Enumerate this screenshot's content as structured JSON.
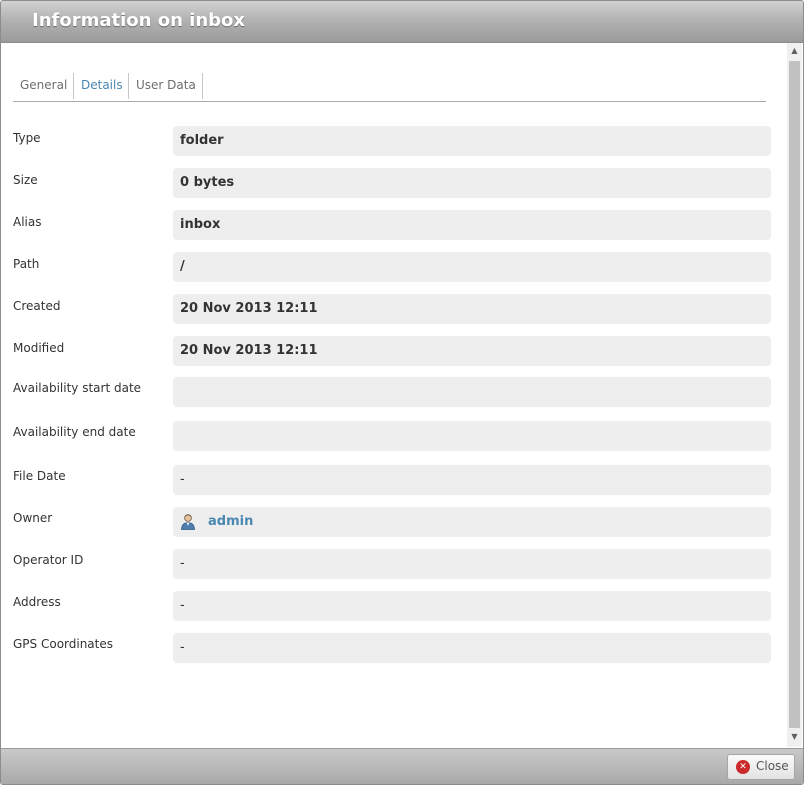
{
  "dialog": {
    "title": "Information on inbox",
    "tabs": [
      {
        "label": "General",
        "active": false
      },
      {
        "label": "Details",
        "active": true
      },
      {
        "label": "User Data",
        "active": false
      }
    ],
    "fields": [
      {
        "label": "Type",
        "value": "folder"
      },
      {
        "label": "Size",
        "value": "0 bytes"
      },
      {
        "label": "Alias",
        "value": "inbox"
      },
      {
        "label": "Path",
        "value": "/"
      },
      {
        "label": "Created",
        "value": "20 Nov 2013 12:11"
      },
      {
        "label": "Modified",
        "value": "20 Nov 2013 12:11"
      },
      {
        "label": "Availability start date",
        "value": ""
      },
      {
        "label": "Availability end date",
        "value": ""
      },
      {
        "label": "File Date",
        "value": "-"
      },
      {
        "label": "Owner",
        "value": "admin",
        "icon": "user-icon"
      },
      {
        "label": "Operator ID",
        "value": "-"
      },
      {
        "label": "Address",
        "value": "-"
      },
      {
        "label": "GPS Coordinates",
        "value": "-"
      }
    ],
    "close_label": "Close",
    "colors": {
      "link": "#4a88b0",
      "field_bg": "#eeeeee",
      "close_icon": "#cc2a2a"
    }
  }
}
